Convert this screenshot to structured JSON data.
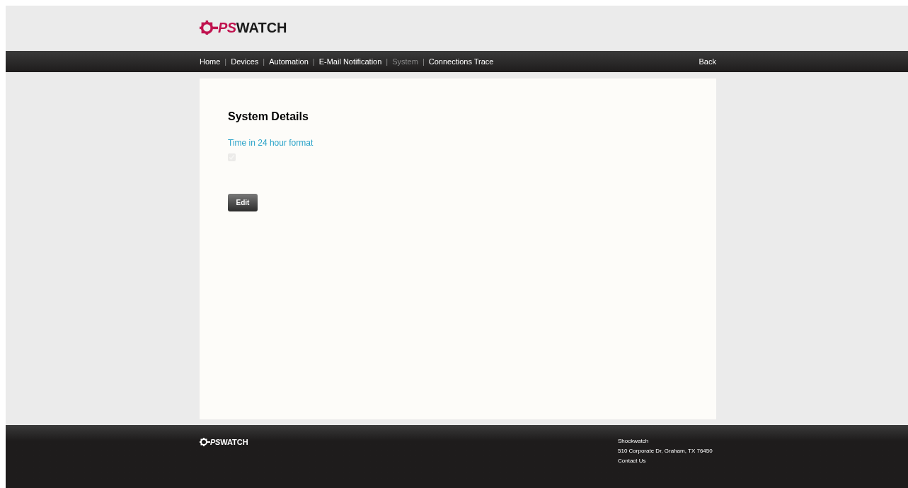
{
  "header": {
    "logo": {
      "accent": "PS",
      "text": "WATCH"
    }
  },
  "nav": {
    "separator": "|",
    "items": [
      {
        "label": "Home",
        "selected": false
      },
      {
        "label": "Devices",
        "selected": false
      },
      {
        "label": "Automation",
        "selected": false
      },
      {
        "label": "E-Mail Notification",
        "selected": false
      },
      {
        "label": "System",
        "selected": true
      },
      {
        "label": "Connections Trace",
        "selected": false
      }
    ],
    "back": "Back"
  },
  "content": {
    "title": "System Details",
    "field": {
      "label": "Time in 24 hour format",
      "checked": true,
      "disabled": true
    },
    "button": "Edit"
  },
  "footer": {
    "logo": {
      "accent": "PS",
      "text": "WATCH"
    },
    "company": "Shockwatch",
    "address": "510 Corporate Dr, Graham, TX 76450",
    "contact": "Contact Us"
  }
}
